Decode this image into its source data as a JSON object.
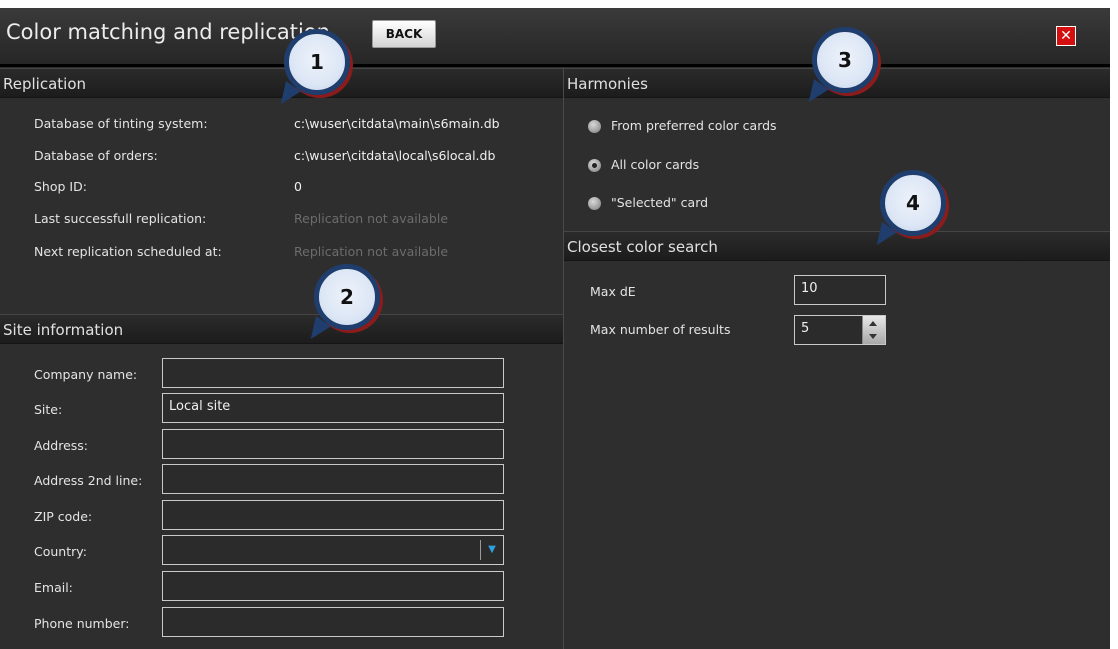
{
  "window": {
    "title": "Color matching and replication",
    "back_label": "BACK",
    "close_glyph": "✕"
  },
  "replication": {
    "header": "Replication",
    "rows": [
      {
        "label": "Database of tinting system:",
        "value": "c:\\wuser\\citdata\\main\\s6main.db"
      },
      {
        "label": "Database of orders:",
        "value": "c:\\wuser\\citdata\\local\\s6local.db"
      },
      {
        "label": "Shop ID:",
        "value": "0"
      },
      {
        "label": "Last successfull replication:",
        "value": "Replication not available"
      },
      {
        "label": "Next replication scheduled at:",
        "value": "Replication not available"
      }
    ]
  },
  "site": {
    "header": "Site information",
    "fields": [
      {
        "label": "Company name:",
        "value": ""
      },
      {
        "label": "Site:",
        "value": "Local site"
      },
      {
        "label": "Address:",
        "value": ""
      },
      {
        "label": "Address 2nd line:",
        "value": ""
      },
      {
        "label": "ZIP code:",
        "value": ""
      },
      {
        "label": "Country:",
        "value": ""
      },
      {
        "label": "Email:",
        "value": ""
      },
      {
        "label": "Phone number:",
        "value": ""
      }
    ]
  },
  "harmonies": {
    "header": "Harmonies",
    "options": [
      {
        "label": "From preferred color cards",
        "selected": false
      },
      {
        "label": "All color cards",
        "selected": true
      },
      {
        "label": "\"Selected\" card",
        "selected": false
      }
    ]
  },
  "closest": {
    "header": "Closest color search",
    "max_de_label": "Max dE",
    "max_de_value": "10",
    "max_results_label": "Max number of results",
    "max_results_value": "5"
  },
  "callouts": [
    "1",
    "2",
    "3",
    "4"
  ],
  "colors": {
    "background": "#2e2e2e",
    "close_button": "#d30f0f",
    "callout_border": "#1f3e6d",
    "dropdown_arrow": "#2f9fe0"
  }
}
